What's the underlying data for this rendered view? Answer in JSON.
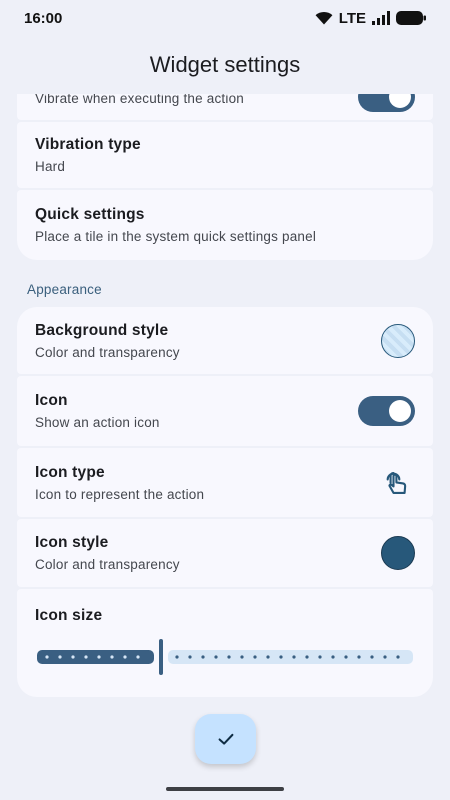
{
  "status_bar": {
    "time": "16:00",
    "network": "LTE"
  },
  "app_bar": {
    "title": "Widget settings"
  },
  "top_group": {
    "partial_item": {
      "subtitle": "Vibrate when executing the action"
    },
    "vibration_type": {
      "title": "Vibration type",
      "subtitle": "Hard"
    },
    "quick_settings": {
      "title": "Quick settings",
      "subtitle": "Place a tile in the system quick settings panel"
    }
  },
  "appearance": {
    "header": "Appearance",
    "background_style": {
      "title": "Background style",
      "subtitle": "Color and transparency",
      "color": "#d8ecfb"
    },
    "icon": {
      "title": "Icon",
      "subtitle": "Show an action icon",
      "enabled": true
    },
    "icon_type": {
      "title": "Icon type",
      "subtitle": "Icon to represent the action",
      "icon": "touch-app-icon"
    },
    "icon_style": {
      "title": "Icon style",
      "subtitle": "Color and transparency",
      "color": "#27587a"
    },
    "icon_size": {
      "title": "Icon size",
      "value_fraction": 0.33
    }
  },
  "colors": {
    "accent": "#3a5f82",
    "section_header": "#3a5f7d",
    "fab": "#c5e2ff",
    "track_inactive": "#d6e6f6"
  },
  "fab": {
    "icon": "check-icon"
  }
}
